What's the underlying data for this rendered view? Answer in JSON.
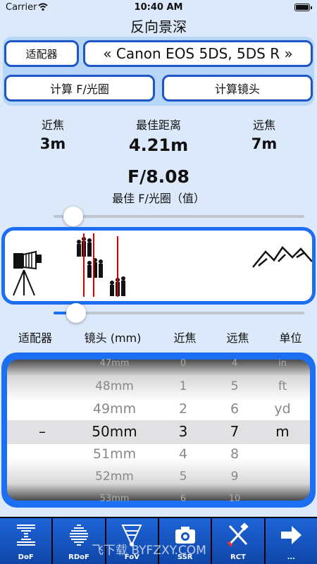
{
  "status": {
    "carrier": "Carrier",
    "time": "10:40 AM"
  },
  "title": "反向景深",
  "buttons": {
    "adapter": "适配器",
    "camera": "« Canon EOS 5DS, 5DS R »",
    "calc_fstop": "计算 F/光圈",
    "calc_lens": "计算镜头"
  },
  "readout": {
    "near_label": "近焦",
    "near_value": "3m",
    "best_label": "最佳距离",
    "best_value": "4.21m",
    "far_label": "远焦",
    "far_value": "7m"
  },
  "aperture": {
    "value": "F/8.08",
    "caption": "最佳 F/光圈（值）"
  },
  "sliders": {
    "top_level": 0.04,
    "bottom_level": 0.05
  },
  "picker_headers": {
    "adapter": "适配器",
    "lens": "镜头 (mm)",
    "near": "近焦",
    "far": "远焦",
    "unit": "单位"
  },
  "picker": {
    "adapter": {
      "selected": "–"
    },
    "lens": [
      "47mm",
      "48mm",
      "49mm",
      "50mm",
      "51mm",
      "52mm",
      "53mm"
    ],
    "near": [
      "0",
      "1",
      "2",
      "3",
      "4",
      "5",
      "6"
    ],
    "far": [
      "4",
      "5",
      "6",
      "7",
      "8",
      "9",
      "10"
    ],
    "unit": [
      "in",
      "ft",
      "yd",
      "m"
    ]
  },
  "toolbar": [
    {
      "label": "DoF",
      "icon": "dof-icon"
    },
    {
      "label": "RDoF",
      "icon": "rdof-icon"
    },
    {
      "label": "FoV",
      "icon": "fov-icon"
    },
    {
      "label": "SSR",
      "icon": "camera-icon"
    },
    {
      "label": "RCT",
      "icon": "tools-icon"
    },
    {
      "label": "...",
      "icon": "arrow-right-icon"
    }
  ],
  "watermark": "飞下载 BYFZXY.COM",
  "colors": {
    "accent": "#1c6ff0",
    "button_border": "#1c56c7",
    "panel": "#b8d6f7",
    "background": "#dbe9fb",
    "focus_line": "#d00000"
  }
}
